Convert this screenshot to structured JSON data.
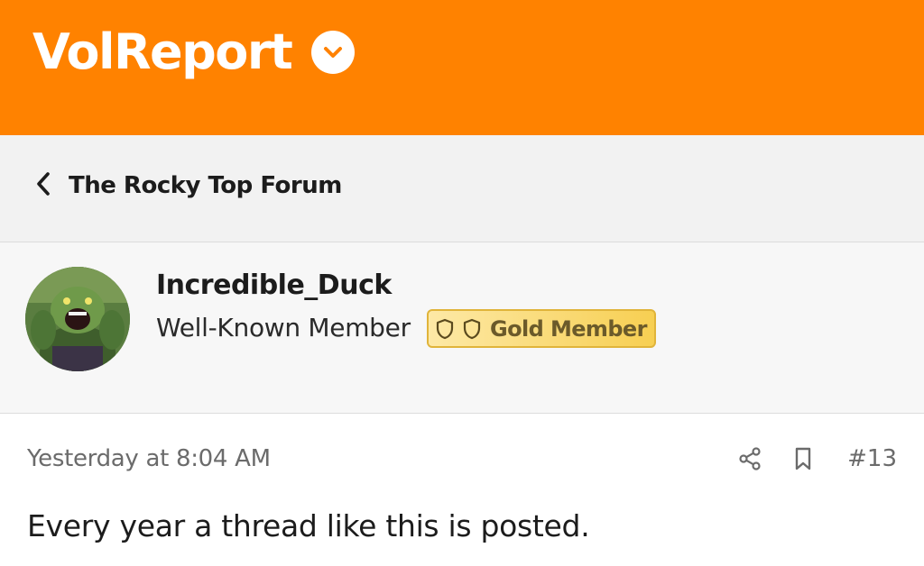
{
  "header": {
    "site_name": "VolReport",
    "brand_color": "#ff8200",
    "menu_icon": "chevron-down-icon"
  },
  "breadcrumb": {
    "back_icon": "chevron-left-icon",
    "label": "The Rocky Top Forum"
  },
  "user": {
    "avatar": "avatar-image",
    "name": "Incredible_Duck",
    "title": "Well-Known Member",
    "badge": {
      "label": "Gold Member",
      "icons": [
        "shield-icon",
        "shield-icon"
      ],
      "color": "#f7cf52"
    }
  },
  "post": {
    "timestamp": "Yesterday at 8:04 AM",
    "number": "#13",
    "actions": [
      "share-icon",
      "bookmark-icon"
    ],
    "body": "Every year a thread like this is posted."
  }
}
